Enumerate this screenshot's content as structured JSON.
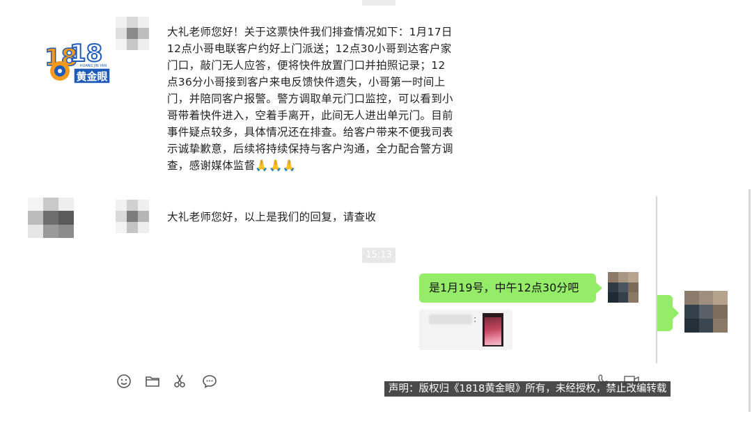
{
  "watermark": {
    "logo_number": "1818",
    "logo_sub": "黄金眼",
    "logo_pinyin": "HUANG JIN YAN"
  },
  "messages": [
    {
      "sender": "other",
      "text": "大礼老师您好！关于这票快件我们排查情况如下：1月17日12点小哥电联客户约好上门派送；12点30小哥到达客户家门口，敲门无人应答，便将快件放置门口并拍照记录；12点36分小哥接到客户来电反馈快件遗失，小哥第一时间上门，并陪同客户报警。警方调取单元门口监控，可以看到小哥带着快件进入，空着手离开，此间无人进出单元门。目前事件疑点较多，具体情况还在排查。给客户带来不便我司表示诚挚歉意，后续将持续保持与客户沟通，全力配合警方调查，感谢媒体监督🙏🙏🙏"
    },
    {
      "sender": "other",
      "text": "大礼老师您好，以上是我们的回复，请查收"
    },
    {
      "sender": "me",
      "text": "是1月19号，中午12点30分吧"
    }
  ],
  "timestamp": "15:13",
  "quote_colon": ":",
  "toolbar": {
    "icons": [
      "emoji-icon",
      "folder-icon",
      "scissors-icon",
      "chat-bubble-icon"
    ]
  },
  "disclaimer": "声明：版权归《1818黄金眼》所有，未经授权，禁止改编转载",
  "colors": {
    "my_bubble": "#95ec69",
    "timestamp_chip": "#e8e8e8",
    "logo_orange": "#f39a1e",
    "logo_blue": "#1e5bb8"
  }
}
